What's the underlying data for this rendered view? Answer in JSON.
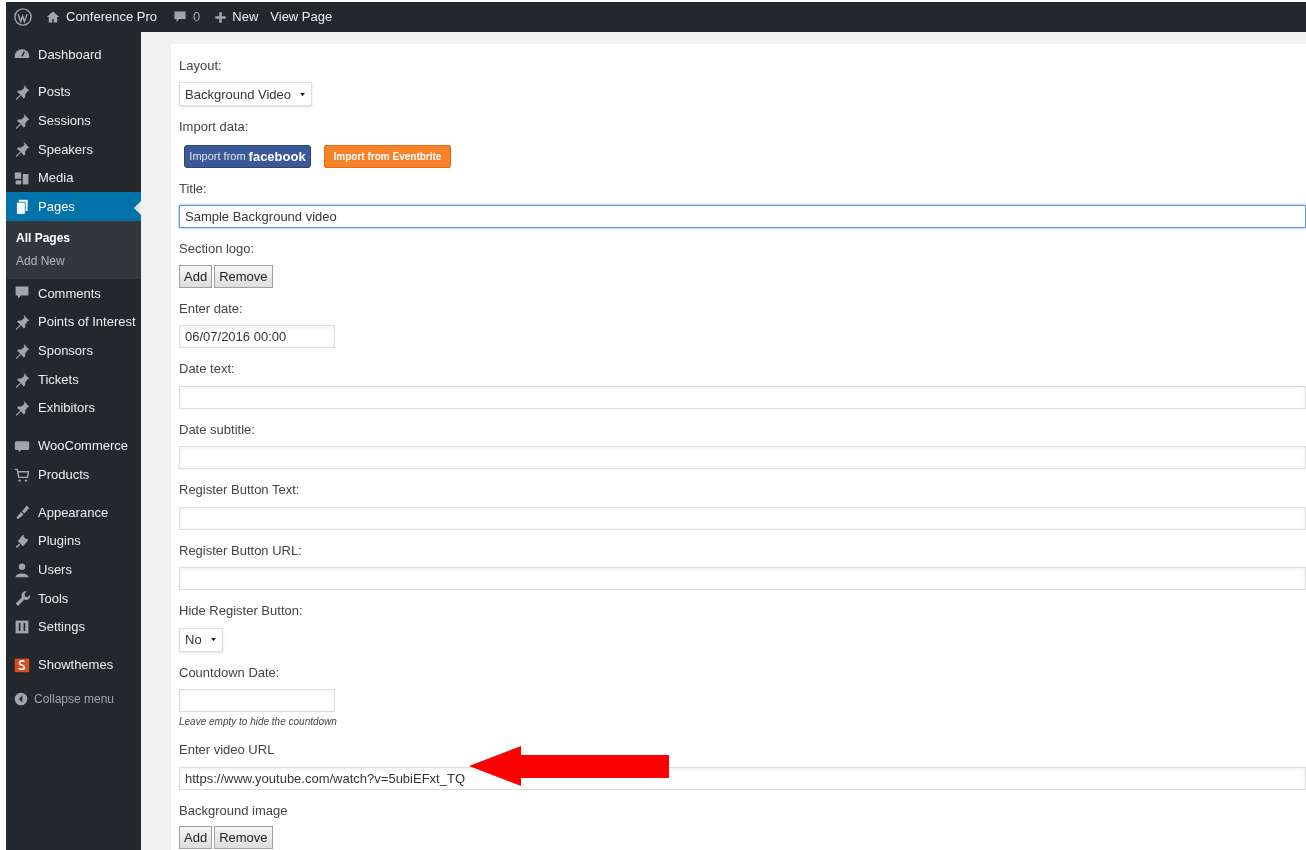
{
  "admin_bar": {
    "site_name": "Conference Pro",
    "comments_count": "0",
    "new_label": "New",
    "view_label": "View Page"
  },
  "sidebar": {
    "groups": [
      [
        {
          "label": "Dashboard",
          "selected": false
        }
      ],
      [
        {
          "label": "Posts",
          "selected": false
        },
        {
          "label": "Sessions",
          "selected": false
        },
        {
          "label": "Speakers",
          "selected": false
        },
        {
          "label": "Media",
          "selected": false
        },
        {
          "label": "Pages",
          "selected": true,
          "children": [
            {
              "label": "All Pages",
              "selected": true
            },
            {
              "label": "Add New",
              "selected": false
            }
          ]
        },
        {
          "label": "Comments",
          "selected": false
        },
        {
          "label": "Points of Interest",
          "selected": false
        },
        {
          "label": "Sponsors",
          "selected": false
        },
        {
          "label": "Tickets",
          "selected": false
        },
        {
          "label": "Exhibitors",
          "selected": false
        }
      ],
      [
        {
          "label": "WooCommerce",
          "selected": false
        },
        {
          "label": "Products",
          "selected": false
        }
      ],
      [
        {
          "label": "Appearance",
          "selected": false
        },
        {
          "label": "Plugins",
          "selected": false
        },
        {
          "label": "Users",
          "selected": false
        },
        {
          "label": "Tools",
          "selected": false
        },
        {
          "label": "Settings",
          "selected": false
        }
      ],
      [
        {
          "label": "Showthemes",
          "selected": false
        }
      ]
    ],
    "collapse_label": "Collapse menu"
  },
  "form": {
    "fields": [
      {
        "kind": "select",
        "label": "Layout:",
        "value": "Background Video"
      },
      {
        "kind": "import",
        "label": "Import data:",
        "buttons": [
          {
            "kind": "facebook",
            "prefix": "Import from",
            "brand": "facebook"
          },
          {
            "kind": "eventbrite",
            "prefix": "Import from Eventbrite"
          }
        ]
      },
      {
        "kind": "text",
        "label": "Title:",
        "value": "Sample Background video",
        "focused": true
      },
      {
        "kind": "media",
        "label": "Section logo:",
        "buttons": [
          "Add",
          "Remove"
        ]
      },
      {
        "kind": "date",
        "label": "Enter date:",
        "value": "06/07/2016 00:00",
        "focused": false
      },
      {
        "kind": "text",
        "label": "Date text:",
        "focused": false
      },
      {
        "kind": "text",
        "label": "Date subtitle:",
        "focused": false
      },
      {
        "kind": "text",
        "label": "Register Button Text:",
        "focused": false
      },
      {
        "kind": "text",
        "label": "Register Button URL:",
        "focused": false
      },
      {
        "kind": "select",
        "label": "Hide Register Button:",
        "value": "No"
      },
      {
        "kind": "date",
        "label": "Countdown Date:",
        "focused": false,
        "hint": "Leave empty to hide the countdown"
      },
      {
        "kind": "text",
        "label": "Enter video URL",
        "value": "https://www.youtube.com/watch?v=5ubiEFxt_TQ",
        "focused": false,
        "annotated": true
      },
      {
        "kind": "media",
        "label": "Background image",
        "buttons": [
          "Add",
          "Remove"
        ]
      }
    ]
  }
}
